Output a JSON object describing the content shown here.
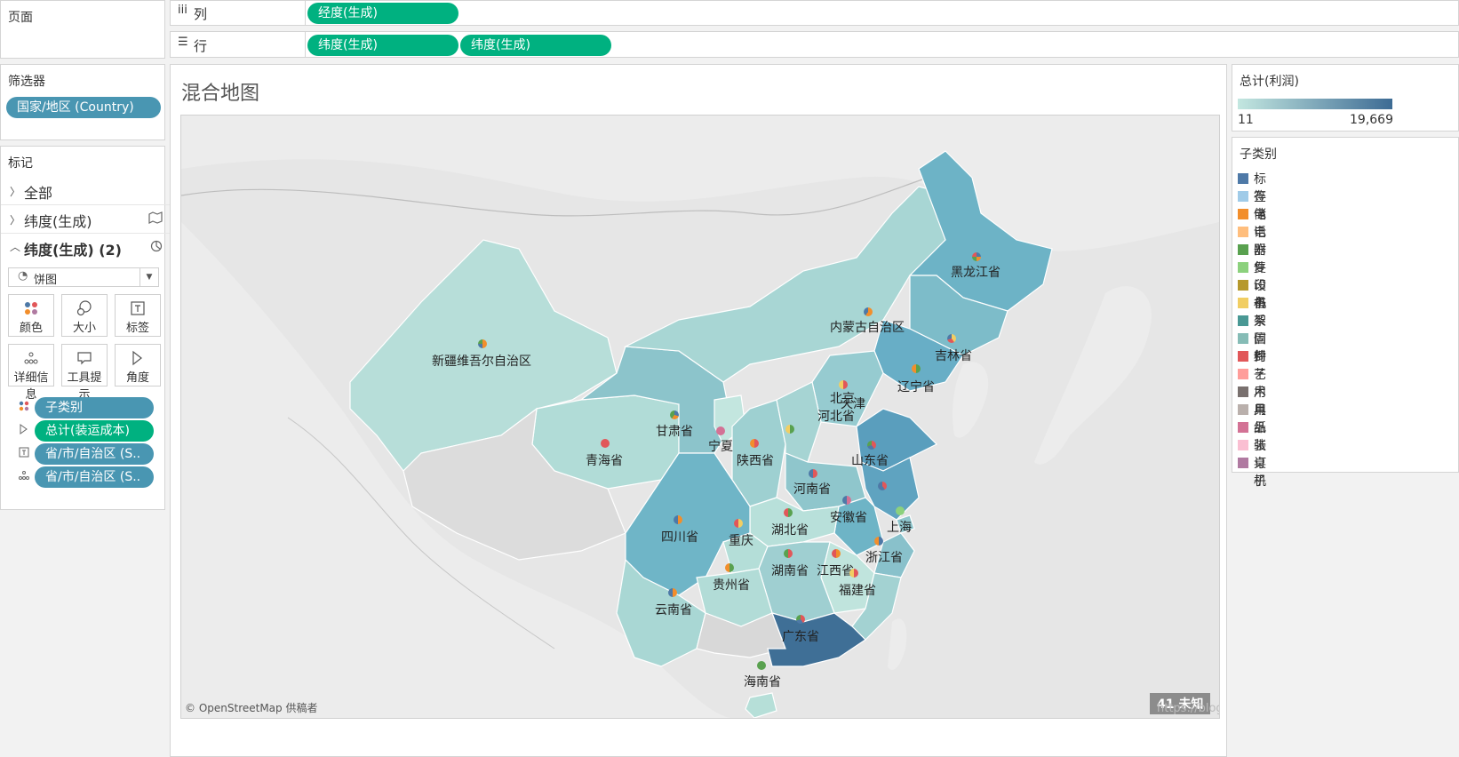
{
  "pages_shelf": {
    "title": "页面"
  },
  "columns_shelf": {
    "icon": "iii",
    "label": "列",
    "pills": [
      "经度(生成)"
    ]
  },
  "rows_shelf": {
    "icon": "☰",
    "label": "行",
    "pills": [
      "纬度(生成)",
      "纬度(生成)"
    ]
  },
  "filters": {
    "title": "筛选器",
    "pills": [
      "国家/地区 (Country)"
    ]
  },
  "marks": {
    "title": "标记",
    "layers": [
      {
        "label": "全部",
        "expanded": false
      },
      {
        "label": "纬度(生成)",
        "expanded": false
      },
      {
        "label": "纬度(生成) (2)",
        "expanded": true
      }
    ],
    "mark_type": "饼图",
    "buttons": [
      "颜色",
      "大小",
      "标签",
      "详细信息",
      "工具提示",
      "角度"
    ],
    "encodings": [
      {
        "icon": "color",
        "label": "子类别",
        "color": "blue"
      },
      {
        "icon": "angle",
        "label": "总计(装运成本)",
        "color": "green"
      },
      {
        "icon": "label",
        "label": "省/市/自治区 (S..",
        "color": "blue"
      },
      {
        "icon": "detail",
        "label": "省/市/自治区 (S..",
        "color": "blue"
      }
    ]
  },
  "view": {
    "title": "混合地图",
    "attribution": "© OpenStreetMap 供稿者",
    "unknown_badge": "41 未知",
    "watermark": "https://blog.csdn.net/weixin_43196531"
  },
  "map_labels": [
    "黑龙江省",
    "内蒙古自治区",
    "吉林省",
    "辽宁省",
    "新疆维吾尔自治区",
    "北京",
    "天津",
    "河北省",
    "甘肃省",
    "宁夏",
    "山东省",
    "陕西省",
    "青海省",
    "河南省",
    "安徽省",
    "上海",
    "四川省",
    "湖北省",
    "重庆",
    "浙江省",
    "湖南省",
    "江西省",
    "贵州省",
    "福建省",
    "云南省",
    "广东省",
    "海南省"
  ],
  "profit_legend": {
    "title": "总计(利润)",
    "min": "11",
    "max": "19,669",
    "color_low": "#c3e7e0",
    "color_high": "#3d6b94"
  },
  "subcategory_legend": {
    "title": "子类别",
    "items": [
      {
        "name": "标签",
        "color": "#4e79a7"
      },
      {
        "name": "存储",
        "color": "#a0cbe8"
      },
      {
        "name": "电话",
        "color": "#f28e2b"
      },
      {
        "name": "电器",
        "color": "#ffbe7d"
      },
      {
        "name": "附件",
        "color": "#59a14f"
      },
      {
        "name": "复印机",
        "color": "#8cd17d"
      },
      {
        "name": "设备",
        "color": "#b6992d"
      },
      {
        "name": "书架",
        "color": "#f1ce63"
      },
      {
        "name": "系固件",
        "color": "#499894"
      },
      {
        "name": "信封",
        "color": "#86bcb6"
      },
      {
        "name": "椅子",
        "color": "#e15759"
      },
      {
        "name": "艺术",
        "color": "#ff9d9a"
      },
      {
        "name": "用具",
        "color": "#79706e"
      },
      {
        "name": "用品",
        "color": "#bab0ac"
      },
      {
        "name": "纸张",
        "color": "#d37295"
      },
      {
        "name": "装订机",
        "color": "#fabfd2"
      },
      {
        "name": "桌子",
        "color": "#b07aa1"
      }
    ]
  }
}
